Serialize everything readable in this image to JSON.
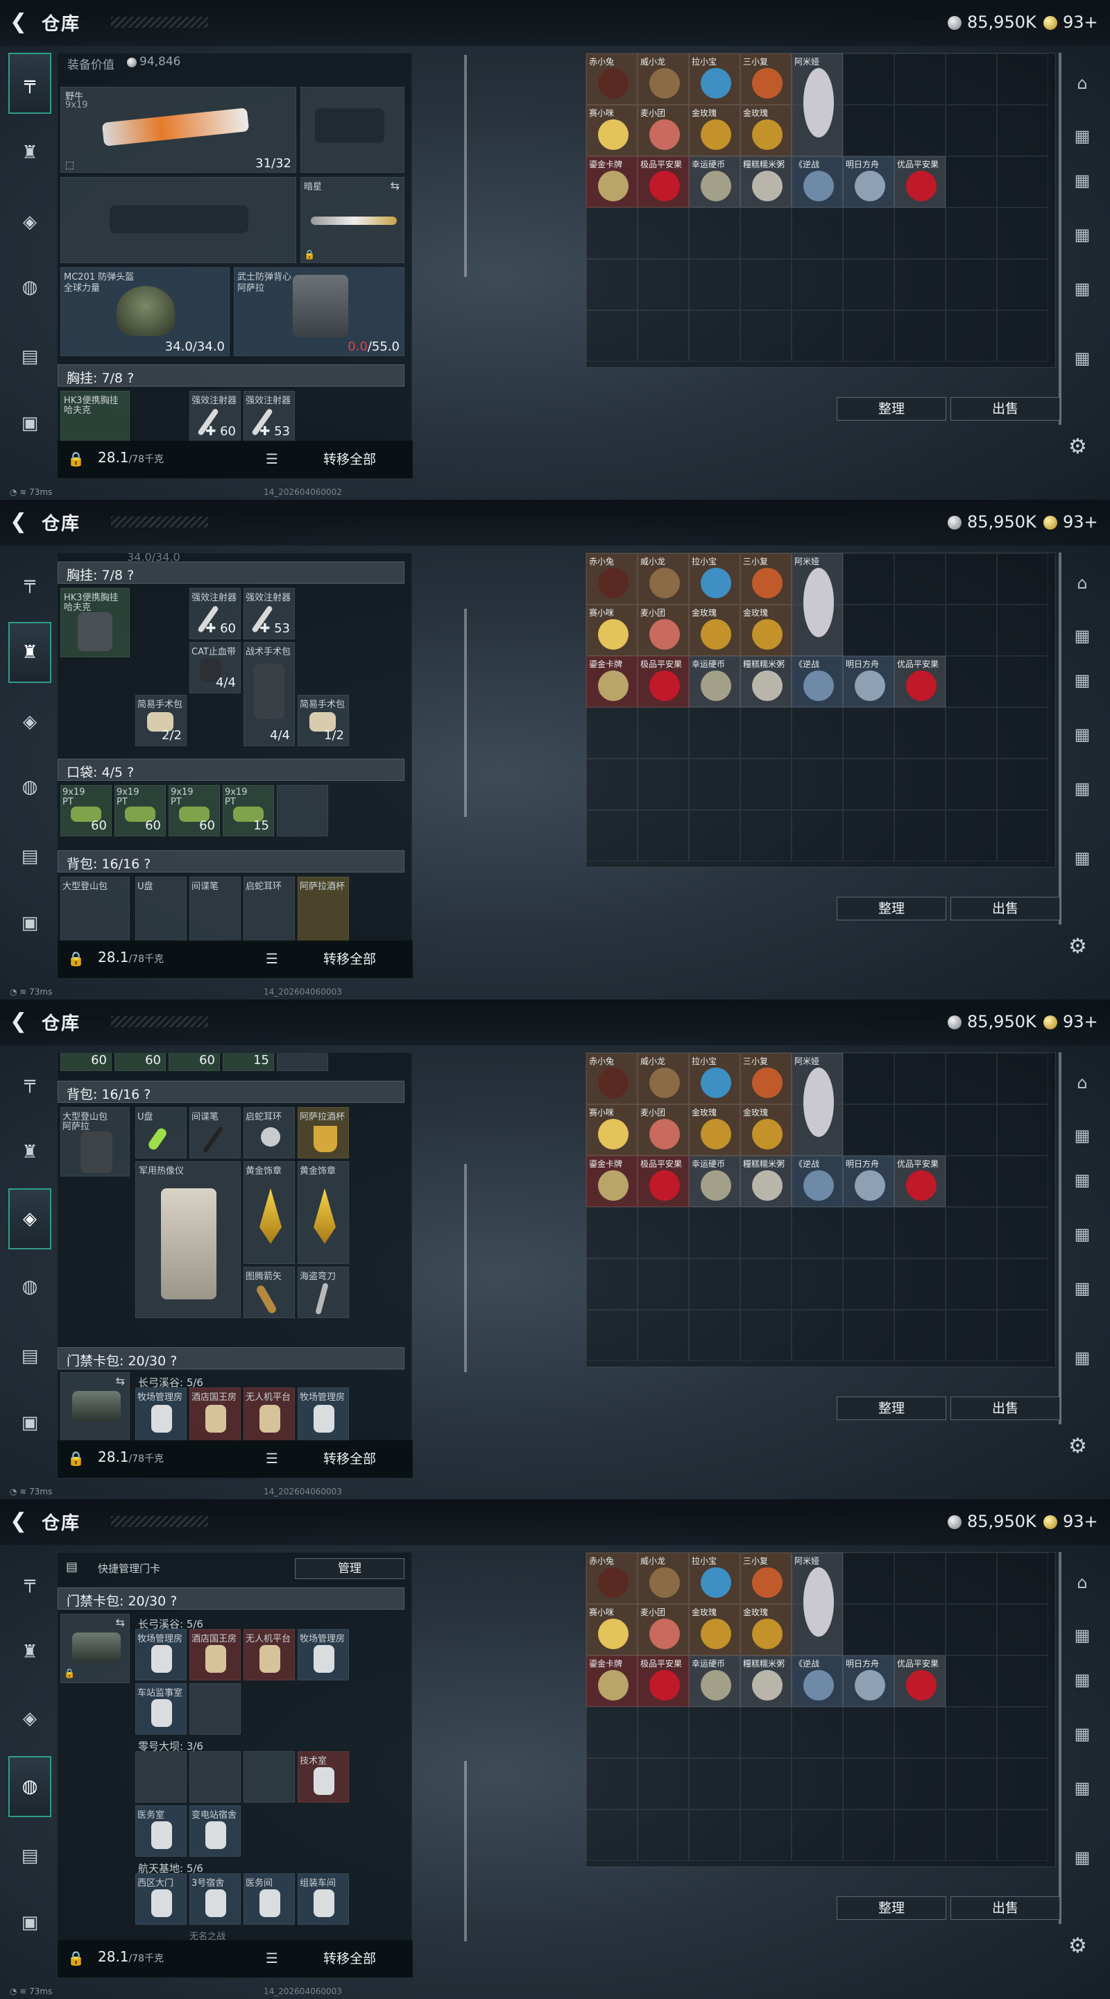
{
  "header": {
    "title": "仓库",
    "silver": "85,950K",
    "gold": "93+"
  },
  "status": {
    "ping": "73ms"
  },
  "stamps": [
    "14_202604060002",
    "14_202604060003",
    "14_202604060003",
    "14_202604060003"
  ],
  "footer": {
    "weight": "28.1",
    "weight_max": "/78千克",
    "transfer_all": "转移全部"
  },
  "stash": {
    "sort_button": "整理",
    "sell_button": "出售",
    "rows": [
      [
        {
          "label": "赤小兔",
          "color": "o",
          "art": "#5a2a22"
        },
        {
          "label": "威小龙",
          "color": "o",
          "art": "#8a6b45"
        },
        {
          "label": "拉小宝",
          "color": "o",
          "art": "#3d8fc4"
        },
        {
          "label": "三小复",
          "color": "o",
          "art": "#c15a2a"
        },
        {
          "label": "阿米娅",
          "color": "gy",
          "art": "#c9c9cf"
        }
      ],
      [
        {
          "label": "赛小咪",
          "color": "o",
          "art": "#e3c35a"
        },
        {
          "label": "麦小团",
          "color": "o",
          "art": "#c96a5e"
        },
        {
          "label": "金玫瑰",
          "color": "o",
          "art": "#c4922a"
        },
        {
          "label": "金玫瑰",
          "color": "o",
          "art": "#c4922a"
        }
      ],
      [
        {
          "label": "鎏金卡牌",
          "color": "rr",
          "art": "#b9a46a"
        },
        {
          "label": "极品平安果",
          "color": "rr",
          "art": "#c0192a"
        },
        {
          "label": "幸运硬币",
          "color": "gy",
          "art": "#a3a08a"
        },
        {
          "label": "糧糕糯米粥",
          "color": "gy",
          "art": "#b8b6aa"
        },
        {
          "label": "《逆战",
          "color": "bb",
          "art": "#6f8aa6"
        },
        {
          "label": "明日方舟",
          "color": "bb",
          "art": "#8ea0b4"
        },
        {
          "label": "优品平安果",
          "color": "gy",
          "art": "#c0192a"
        }
      ]
    ]
  },
  "panels": {
    "p1": {
      "equip_value_label": "装备价值",
      "equip_value": "94,846",
      "gun_name": "野牛",
      "gun_ammo": "9x19",
      "gun_count": "31/32",
      "knife_name": "暗星",
      "helmet_name": "MC201 防弹头盔",
      "helmet_sub": "全球力量",
      "helmet_dur": "34.0/34.0",
      "armor_name": "武士防弹背心",
      "armor_sub": "阿萨拉",
      "armor_dur_cur": "0.0",
      "armor_dur_max": "/55.0",
      "rig_header": "胸挂: 7/8",
      "rig_name": "HK3便携胸挂",
      "rig_sub": "哈夫克",
      "inj1": "强效注射器",
      "inj2": "强效注射器",
      "inj1_n": "60",
      "inj2_n": "53"
    },
    "p2": {
      "partial": "34.0/34.0",
      "rig_header": "胸挂: 7/8",
      "rig_name": "HK3便携胸挂",
      "rig_sub": "哈夫克",
      "inj1": "强效注射器",
      "inj2": "强效注射器",
      "inj1_n": "60",
      "inj2_n": "53",
      "tq": "CAT止血带",
      "tq_n": "4/4",
      "kit": "战术手术包",
      "kit_n": "4/4",
      "sk1": "简易手术包",
      "sk1_n": "2/2",
      "sk2": "简易手术包",
      "sk2_n": "1/2",
      "pocket_header": "口袋: 4/5",
      "ammo": [
        "9x19",
        "9x19",
        "9x19",
        "9x19"
      ],
      "ammo_sub": "PT",
      "ammo_n": [
        "60",
        "60",
        "60",
        "15"
      ],
      "bag_header": "背包: 16/16",
      "bag_items": [
        "大型登山包",
        "U盘",
        "间谍笔",
        "启蛇耳环",
        "阿萨拉酒杯"
      ]
    },
    "p3": {
      "ammo_n": [
        "60",
        "60",
        "60",
        "15"
      ],
      "bag_header": "背包: 16/16",
      "bag_name": "大型登山包",
      "bag_sub": "阿萨拉",
      "bag_items": [
        "U盘",
        "间谍笔",
        "启蛇耳环",
        "阿萨拉酒杯"
      ],
      "thermal": "军用热像仪",
      "gold1": "黄金饰章",
      "gold2": "黄金饰章",
      "arrow": "图腾箭矢",
      "dagger": "海盗弯刀",
      "card_header": "门禁卡包: 20/30",
      "map1": "长弓溪谷: 5/6",
      "cards": [
        "牧场管理房",
        "酒店国王房",
        "无人机平台",
        "牧场管理房"
      ]
    },
    "p4": {
      "quick_label": "快捷管理门卡",
      "manage_button": "管理",
      "card_header": "门禁卡包: 20/30",
      "map1": "长弓溪谷: 5/6",
      "cards1": [
        "牧场管理房",
        "酒店国王房",
        "无人机平台",
        "牧场管理房"
      ],
      "card1b": "车站监事室",
      "map2": "零号大坝: 3/6",
      "card2": "技术室",
      "cards2b": [
        "医务室",
        "变电站宿舍"
      ],
      "map3": "航天基地: 5/6",
      "cards3": [
        "西区大门",
        "3号宿舍",
        "医务间",
        "组装车间"
      ],
      "card3b": "无名之战"
    }
  }
}
